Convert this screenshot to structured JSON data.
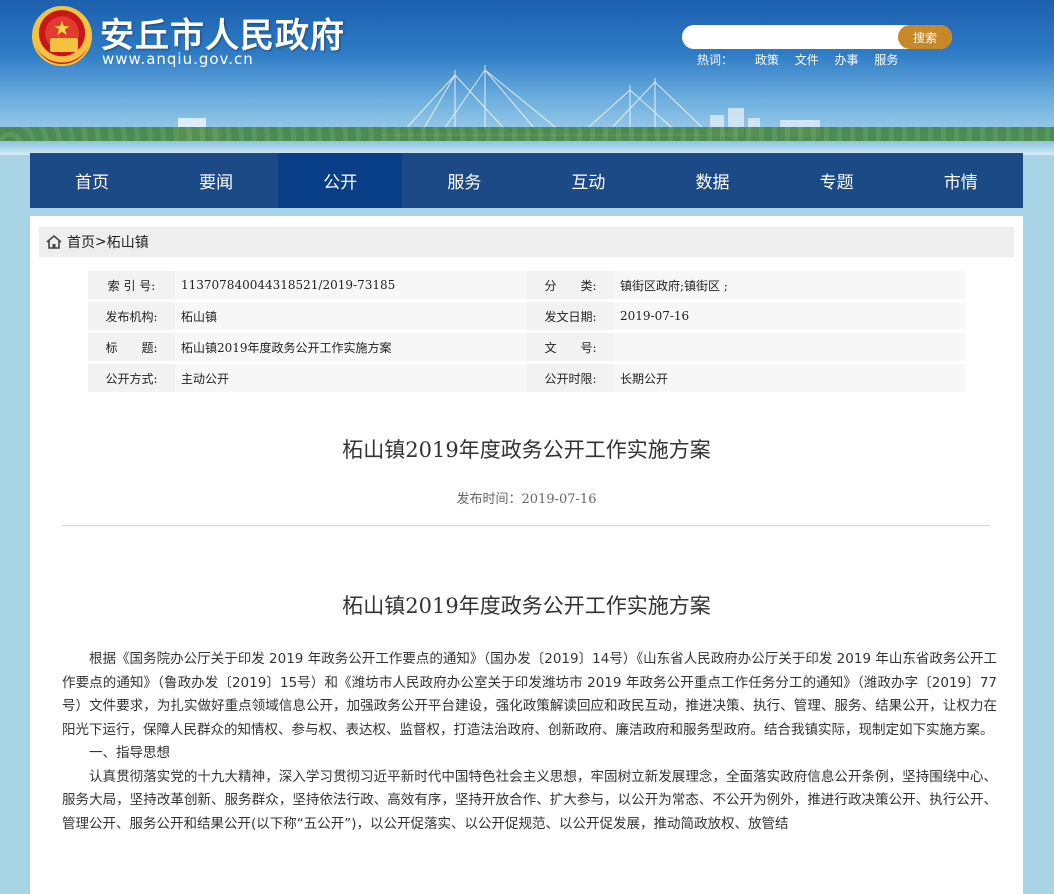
{
  "header": {
    "site_title": "安丘市人民政府",
    "site_url": "www.anqiu.gov.cn",
    "search": {
      "placeholder": "",
      "button_label": "搜索"
    },
    "hot": {
      "label": "热词：",
      "words": [
        "政策",
        "文件",
        "办事",
        "服务"
      ]
    }
  },
  "nav": {
    "items": [
      "首页",
      "要闻",
      "公开",
      "服务",
      "互动",
      "数据",
      "专题",
      "市情"
    ],
    "active_index": 2
  },
  "breadcrumb": {
    "home": "首页",
    "separator": ">",
    "current": "柘山镇"
  },
  "meta": {
    "rows": [
      {
        "label1": "索 引 号:",
        "value1": "113707840044318521/2019-73185",
        "label2": "分　　类:",
        "value2": "镇街区政府;镇街区 ;"
      },
      {
        "label1": "发布机构:",
        "value1": "柘山镇",
        "label2": "发文日期:",
        "value2": "2019-07-16"
      },
      {
        "label1": "标　　题:",
        "value1": "柘山镇2019年度政务公开工作实施方案",
        "label2": "文　　号:",
        "value2": ""
      },
      {
        "label1": "公开方式:",
        "value1": "主动公开",
        "label2": "公开时限:",
        "value2": "长期公开"
      }
    ]
  },
  "doc": {
    "title": "柘山镇2019年度政务公开工作实施方案",
    "pub_date": "发布时间：2019-07-16",
    "body_title": "柘山镇2019年度政务公开工作实施方案",
    "paragraphs": [
      "根据《国务院办公厅关于印发 2019 年政务公开工作要点的通知》（国办发〔2019〕14号）《山东省人民政府办公厅关于印发 2019 年山东省政务公开工作要点的通知》（鲁政办发〔2019〕15号）和《潍坊市人民政府办公室关于印发潍坊市 2019 年政务公开重点工作任务分工的通知》（潍政办字〔2019〕77号）文件要求，为扎实做好重点领域信息公开，加强政务公开平台建设，强化政策解读回应和政民互动，推进决策、执行、管理、服务、结果公开，让权力在阳光下运行，保障人民群众的知情权、参与权、表达权、监督权，打造法治政府、创新政府、廉洁政府和服务型政府。结合我镇实际，现制定如下实施方案。",
      "一、指导思想",
      "认真贯彻落实党的十九大精神，深入学习贯彻习近平新时代中国特色社会主义思想，牢固树立新发展理念，全面落实政府信息公开条例，坚持围绕中心、服务大局，坚持改革创新、服务群众，坚持依法行政、高效有序，坚持开放合作、扩大参与，以公开为常态、不公开为例外，推进行政决策公开、执行公开、管理公开、服务公开和结果公开(以下称“五公开”)，以公开促落实、以公开促规范、以公开促发展，推动简政放权、放管结"
    ]
  }
}
